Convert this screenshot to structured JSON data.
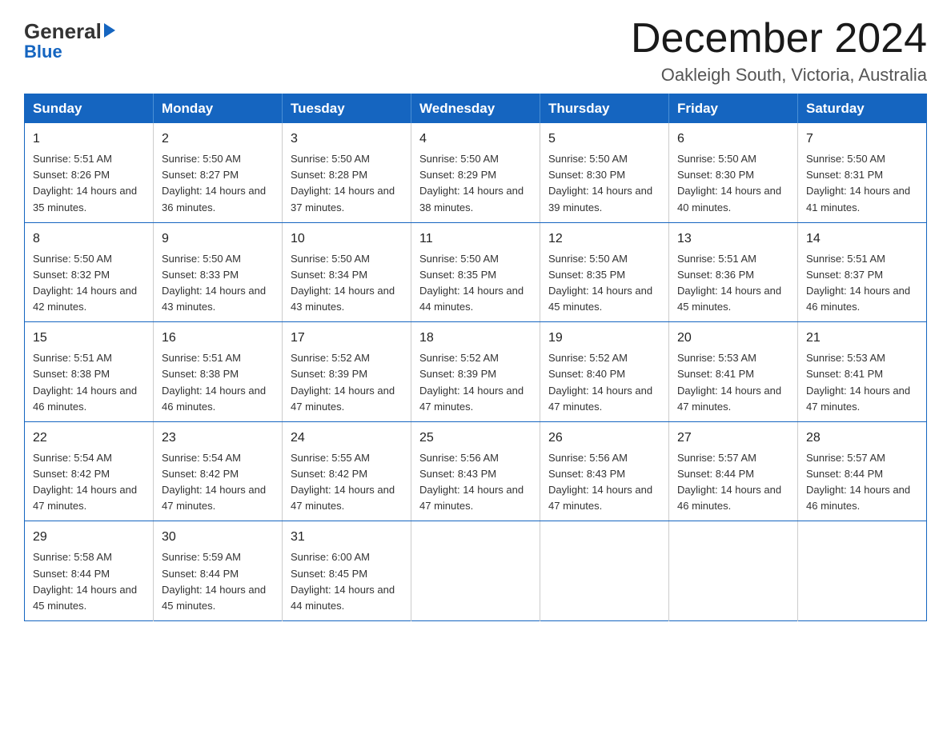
{
  "logo": {
    "general": "General",
    "blue": "Blue"
  },
  "header": {
    "month": "December 2024",
    "location": "Oakleigh South, Victoria, Australia"
  },
  "weekdays": [
    "Sunday",
    "Monday",
    "Tuesday",
    "Wednesday",
    "Thursday",
    "Friday",
    "Saturday"
  ],
  "weeks": [
    [
      {
        "day": "1",
        "sunrise": "5:51 AM",
        "sunset": "8:26 PM",
        "daylight": "14 hours and 35 minutes."
      },
      {
        "day": "2",
        "sunrise": "5:50 AM",
        "sunset": "8:27 PM",
        "daylight": "14 hours and 36 minutes."
      },
      {
        "day": "3",
        "sunrise": "5:50 AM",
        "sunset": "8:28 PM",
        "daylight": "14 hours and 37 minutes."
      },
      {
        "day": "4",
        "sunrise": "5:50 AM",
        "sunset": "8:29 PM",
        "daylight": "14 hours and 38 minutes."
      },
      {
        "day": "5",
        "sunrise": "5:50 AM",
        "sunset": "8:30 PM",
        "daylight": "14 hours and 39 minutes."
      },
      {
        "day": "6",
        "sunrise": "5:50 AM",
        "sunset": "8:30 PM",
        "daylight": "14 hours and 40 minutes."
      },
      {
        "day": "7",
        "sunrise": "5:50 AM",
        "sunset": "8:31 PM",
        "daylight": "14 hours and 41 minutes."
      }
    ],
    [
      {
        "day": "8",
        "sunrise": "5:50 AM",
        "sunset": "8:32 PM",
        "daylight": "14 hours and 42 minutes."
      },
      {
        "day": "9",
        "sunrise": "5:50 AM",
        "sunset": "8:33 PM",
        "daylight": "14 hours and 43 minutes."
      },
      {
        "day": "10",
        "sunrise": "5:50 AM",
        "sunset": "8:34 PM",
        "daylight": "14 hours and 43 minutes."
      },
      {
        "day": "11",
        "sunrise": "5:50 AM",
        "sunset": "8:35 PM",
        "daylight": "14 hours and 44 minutes."
      },
      {
        "day": "12",
        "sunrise": "5:50 AM",
        "sunset": "8:35 PM",
        "daylight": "14 hours and 45 minutes."
      },
      {
        "day": "13",
        "sunrise": "5:51 AM",
        "sunset": "8:36 PM",
        "daylight": "14 hours and 45 minutes."
      },
      {
        "day": "14",
        "sunrise": "5:51 AM",
        "sunset": "8:37 PM",
        "daylight": "14 hours and 46 minutes."
      }
    ],
    [
      {
        "day": "15",
        "sunrise": "5:51 AM",
        "sunset": "8:38 PM",
        "daylight": "14 hours and 46 minutes."
      },
      {
        "day": "16",
        "sunrise": "5:51 AM",
        "sunset": "8:38 PM",
        "daylight": "14 hours and 46 minutes."
      },
      {
        "day": "17",
        "sunrise": "5:52 AM",
        "sunset": "8:39 PM",
        "daylight": "14 hours and 47 minutes."
      },
      {
        "day": "18",
        "sunrise": "5:52 AM",
        "sunset": "8:39 PM",
        "daylight": "14 hours and 47 minutes."
      },
      {
        "day": "19",
        "sunrise": "5:52 AM",
        "sunset": "8:40 PM",
        "daylight": "14 hours and 47 minutes."
      },
      {
        "day": "20",
        "sunrise": "5:53 AM",
        "sunset": "8:41 PM",
        "daylight": "14 hours and 47 minutes."
      },
      {
        "day": "21",
        "sunrise": "5:53 AM",
        "sunset": "8:41 PM",
        "daylight": "14 hours and 47 minutes."
      }
    ],
    [
      {
        "day": "22",
        "sunrise": "5:54 AM",
        "sunset": "8:42 PM",
        "daylight": "14 hours and 47 minutes."
      },
      {
        "day": "23",
        "sunrise": "5:54 AM",
        "sunset": "8:42 PM",
        "daylight": "14 hours and 47 minutes."
      },
      {
        "day": "24",
        "sunrise": "5:55 AM",
        "sunset": "8:42 PM",
        "daylight": "14 hours and 47 minutes."
      },
      {
        "day": "25",
        "sunrise": "5:56 AM",
        "sunset": "8:43 PM",
        "daylight": "14 hours and 47 minutes."
      },
      {
        "day": "26",
        "sunrise": "5:56 AM",
        "sunset": "8:43 PM",
        "daylight": "14 hours and 47 minutes."
      },
      {
        "day": "27",
        "sunrise": "5:57 AM",
        "sunset": "8:44 PM",
        "daylight": "14 hours and 46 minutes."
      },
      {
        "day": "28",
        "sunrise": "5:57 AM",
        "sunset": "8:44 PM",
        "daylight": "14 hours and 46 minutes."
      }
    ],
    [
      {
        "day": "29",
        "sunrise": "5:58 AM",
        "sunset": "8:44 PM",
        "daylight": "14 hours and 45 minutes."
      },
      {
        "day": "30",
        "sunrise": "5:59 AM",
        "sunset": "8:44 PM",
        "daylight": "14 hours and 45 minutes."
      },
      {
        "day": "31",
        "sunrise": "6:00 AM",
        "sunset": "8:45 PM",
        "daylight": "14 hours and 44 minutes."
      },
      null,
      null,
      null,
      null
    ]
  ]
}
